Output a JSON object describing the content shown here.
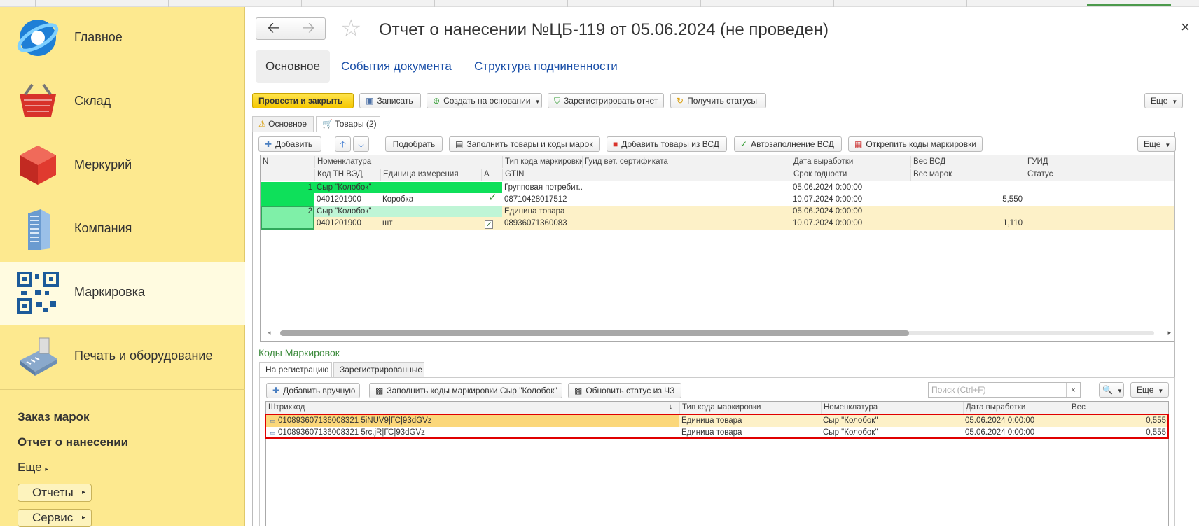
{
  "sidebar": {
    "sections": [
      {
        "label": "Главное",
        "icon": "globe-icon"
      },
      {
        "label": "Склад",
        "icon": "basket-icon"
      },
      {
        "label": "Меркурий",
        "icon": "cube-icon"
      },
      {
        "label": "Компания",
        "icon": "building-icon"
      },
      {
        "label": "Маркировка",
        "icon": "qr-code-icon"
      },
      {
        "label": "Печать и оборудование",
        "icon": "card-terminal-icon"
      }
    ],
    "links": {
      "order_marks": "Заказ марок",
      "report": "Отчет о нанесении",
      "more": "Еще",
      "reports_btn": "Отчеты",
      "service_btn": "Сервис"
    }
  },
  "header": {
    "back": "🡠",
    "forward": "🡢",
    "title": "Отчет о нанесении №ЦБ-119 от 05.06.2024 (не проведен)",
    "close": "×"
  },
  "doc_tabs": [
    "Основное",
    "События документа",
    "Структура подчиненности"
  ],
  "toolbar": {
    "post_close": "Провести и закрыть",
    "save": "Записать",
    "create_based": "Создать на основании",
    "register": "Зарегистрировать отчет",
    "get_status": "Получить статусы",
    "more": "Еще"
  },
  "page_tabs": {
    "main": "Основное",
    "goods": "Товары (2)"
  },
  "goods_toolbar": {
    "add": "Добавить",
    "pick": "Подобрать",
    "fill_goods_codes": "Заполнить товары и коды марок",
    "add_from_vsd": "Добавить товары из ВСД",
    "autofill_vsd": "Автозаполнение ВСД",
    "detach_codes": "Открепить коды маркировки",
    "more": "Еще"
  },
  "goods_table": {
    "headers_top": [
      "N",
      "Номенклатура",
      "Тип кода маркировки",
      "Гуид вет. сертификата",
      "Дата выработки",
      "Вес ВСД",
      "ГУИД"
    ],
    "headers_bottom": [
      "Код ТН ВЭД",
      "Единица измерения",
      "А",
      "GTIN",
      "Срок годности",
      "Вес марок",
      "Статус"
    ],
    "rows": [
      {
        "n": "1",
        "nom": "Сыр \"Колобок\"",
        "code_type": "Групповая потребит...",
        "date": "05.06.2024 0:00:00",
        "tnved": "0401201900",
        "unit": "Коробка",
        "check": "✓",
        "gtin": "08710428017512",
        "expiry": "10.07.2024 0:00:00",
        "weight": "5,550"
      },
      {
        "n": "2",
        "nom": "Сыр \"Колобок\"",
        "code_type": "Единица товара",
        "date": "05.06.2024 0:00:00",
        "tnved": "0401201900",
        "unit": "шт",
        "check": "✓",
        "gtin": "08936071360083",
        "expiry": "10.07.2024 0:00:00",
        "weight": "1,110"
      }
    ]
  },
  "codes_section": {
    "title": "Коды Маркировок",
    "tabs": [
      "На регистрацию",
      "Зарегистрированные"
    ],
    "toolbar": {
      "add_manual": "Добавить вручную",
      "fill_codes": "Заполнить коды маркировки Сыр \"Колобок\"",
      "update_status": "Обновить статус из ЧЗ",
      "search_placeholder": "Поиск (Ctrl+F)",
      "more": "Еще"
    },
    "headers": [
      "Штрихкод",
      "Тип кода маркировки",
      "Номенклатура",
      "Дата выработки",
      "Вес"
    ],
    "rows": [
      {
        "barcode": "010893607136008321 5iNUV9|ГС|93dGVz",
        "type": "Единица товара",
        "nom": "Сыр \"Колобок\"",
        "date": "05.06.2024 0:00:00",
        "weight": "0,555"
      },
      {
        "barcode": "010893607136008321 5rc,jR|ГС|93dGVz",
        "type": "Единица товара",
        "nom": "Сыр \"Колобок\"",
        "date": "05.06.2024 0:00:00",
        "weight": "0,555"
      }
    ]
  }
}
